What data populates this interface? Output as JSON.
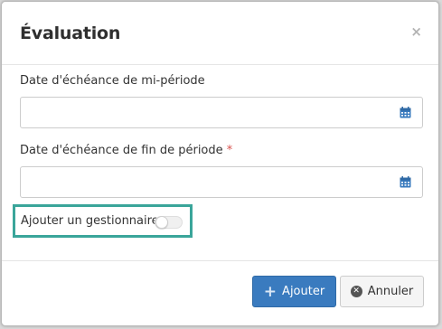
{
  "modal": {
    "title": "Évaluation",
    "close_glyph": "×"
  },
  "fields": {
    "mid_period": {
      "label": "Date d'échéance de mi-période",
      "value": "",
      "icon": "calendar-icon"
    },
    "end_period": {
      "label": "Date d'échéance de fin de période",
      "required_marker": "*",
      "value": "",
      "icon": "calendar-icon"
    }
  },
  "toggle": {
    "label": "Ajouter un gestionnaire",
    "state": "off",
    "highlight_color": "#3aa59a"
  },
  "footer": {
    "add_label": "Ajouter",
    "add_icon": "plus-icon",
    "cancel_label": "Annuler",
    "cancel_icon": "x-circle-icon",
    "primary_color": "#3a7bbf"
  }
}
